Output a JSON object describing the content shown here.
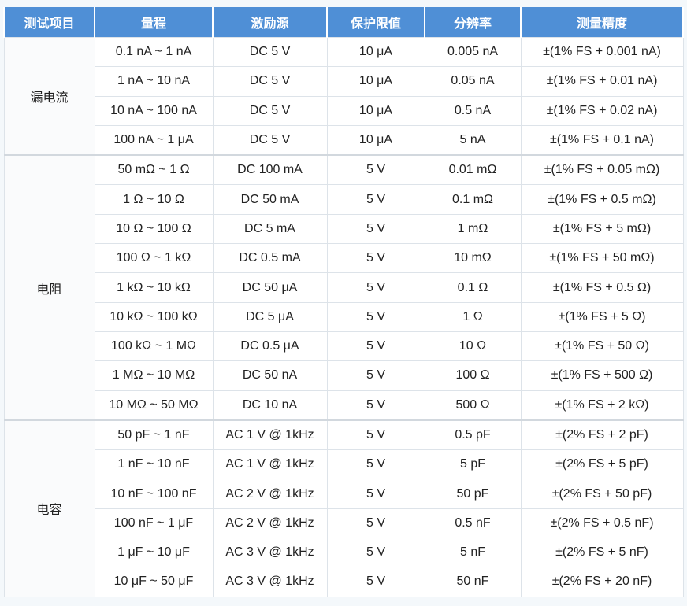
{
  "header": [
    "测试项目",
    "量程",
    "激励源",
    "保护限值",
    "分辨率",
    "测量精度"
  ],
  "groups": [
    {
      "name": "漏电流",
      "rows": [
        [
          "0.1 nA ~ 1 nA",
          "DC 5 V",
          "10 μA",
          "0.005 nA",
          "±(1% FS + 0.001 nA)"
        ],
        [
          "1 nA ~ 10 nA",
          "DC 5 V",
          "10 μA",
          "0.05 nA",
          "±(1% FS + 0.01 nA)"
        ],
        [
          "10 nA ~ 100 nA",
          "DC 5 V",
          "10 μA",
          "0.5 nA",
          "±(1% FS + 0.02 nA)"
        ],
        [
          "100 nA ~ 1 μA",
          "DC 5 V",
          "10 μA",
          "5 nA",
          "±(1% FS + 0.1 nA)"
        ]
      ]
    },
    {
      "name": "电阻",
      "rows": [
        [
          "50 mΩ ~ 1 Ω",
          "DC 100 mA",
          "5 V",
          "0.01 mΩ",
          "±(1% FS + 0.05 mΩ)"
        ],
        [
          "1 Ω ~ 10 Ω",
          "DC 50 mA",
          "5 V",
          "0.1 mΩ",
          "±(1% FS + 0.5 mΩ)"
        ],
        [
          "10 Ω ~ 100 Ω",
          "DC 5 mA",
          "5 V",
          "1 mΩ",
          "±(1% FS + 5 mΩ)"
        ],
        [
          "100 Ω ~ 1 kΩ",
          "DC 0.5 mA",
          "5 V",
          "10 mΩ",
          "±(1% FS + 50 mΩ)"
        ],
        [
          "1 kΩ ~ 10 kΩ",
          "DC 50 μA",
          "5 V",
          "0.1 Ω",
          "±(1% FS + 0.5 Ω)"
        ],
        [
          "10 kΩ ~ 100 kΩ",
          "DC 5 μA",
          "5 V",
          "1 Ω",
          "±(1% FS + 5 Ω)"
        ],
        [
          "100 kΩ ~ 1 MΩ",
          "DC 0.5 μA",
          "5 V",
          "10 Ω",
          "±(1% FS + 50 Ω)"
        ],
        [
          "1 MΩ ~ 10 MΩ",
          "DC 50 nA",
          "5 V",
          "100 Ω",
          "±(1% FS + 500 Ω)"
        ],
        [
          "10 MΩ ~ 50 MΩ",
          "DC 10 nA",
          "5 V",
          "500 Ω",
          "±(1% FS + 2 kΩ)"
        ]
      ]
    },
    {
      "name": "电容",
      "rows": [
        [
          "50 pF ~ 1 nF",
          "AC 1 V @ 1kHz",
          "5 V",
          "0.5 pF",
          "±(2% FS + 2 pF)"
        ],
        [
          "1 nF ~ 10 nF",
          "AC 1 V @ 1kHz",
          "5 V",
          "5 pF",
          "±(2% FS + 5 pF)"
        ],
        [
          "10 nF ~ 100 nF",
          "AC 2 V @ 1kHz",
          "5 V",
          "50 pF",
          "±(2% FS + 50 pF)"
        ],
        [
          "100 nF ~ 1 μF",
          "AC 2 V @ 1kHz",
          "5 V",
          "0.5 nF",
          "±(2% FS + 0.5 nF)"
        ],
        [
          "1 μF ~ 10 μF",
          "AC 3 V @ 1kHz",
          "5 V",
          "5 nF",
          "±(2% FS + 5 nF)"
        ],
        [
          "10 μF ~ 50 μF",
          "AC 3 V @ 1kHz",
          "5 V",
          "50 nF",
          "±(2% FS + 20 nF)"
        ]
      ]
    }
  ]
}
